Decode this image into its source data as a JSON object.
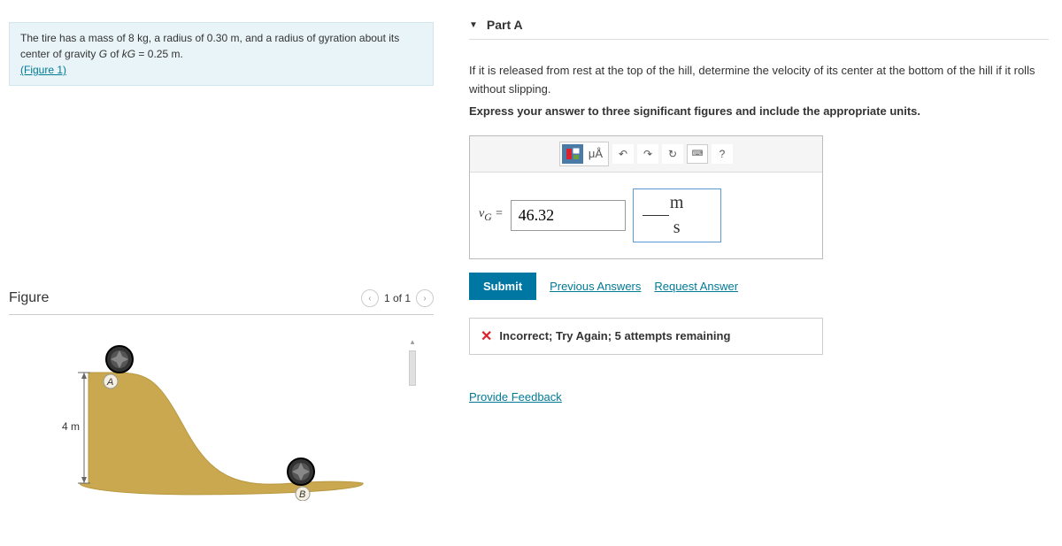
{
  "problem": {
    "text_pre": "The tire has a mass of 8 ",
    "unit_kg": "kg",
    "text_mid1": ", a radius of 0.30 ",
    "unit_m1": "m",
    "text_mid2": ", and a radius of gyration about its center of gravity ",
    "var_G": "G",
    "text_of": " of ",
    "var_kG": "kG",
    "text_eq": " = 0.25 ",
    "unit_m2": "m",
    "text_end": ".",
    "figure_link": "(Figure 1)"
  },
  "figure": {
    "title": "Figure",
    "pager": "1 of 1",
    "height_label": "4 m",
    "point_a": "A",
    "point_b": "B"
  },
  "part": {
    "title": "Part A",
    "question": "If it is released from rest at the top of the hill, determine the velocity of its center at the bottom of the hill if it rolls without slipping.",
    "instruction": "Express your answer to three significant figures and include the appropriate units.",
    "toolbar": {
      "units_btn": "μÅ",
      "help": "?"
    },
    "input": {
      "label_var": "v",
      "label_sub": "G",
      "equals": " = ",
      "value": "46.32",
      "unit_num": "m",
      "unit_den": "s"
    },
    "actions": {
      "submit": "Submit",
      "prev": "Previous Answers",
      "request": "Request Answer"
    },
    "feedback": "Incorrect; Try Again; 5 attempts remaining",
    "provide": "Provide Feedback"
  }
}
